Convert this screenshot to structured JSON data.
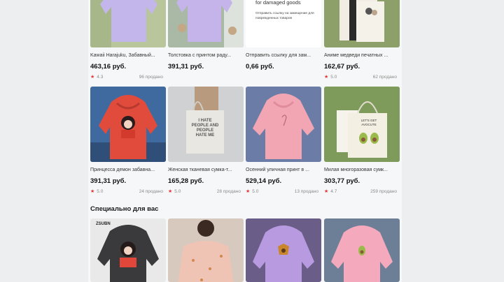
{
  "row1": [
    {
      "title": "Kawaii Harajuku, Забавный...",
      "price": "463,16 руб.",
      "rating": "4.3",
      "sold": "96 продано",
      "bg": "#b7c49a",
      "item": "#c3b6ea"
    },
    {
      "title": "Толстовка с принтом раду...",
      "price": "391,31 руб.",
      "rating": "",
      "sold": "",
      "bg": "#a7b8a3",
      "item": "#c4b4ea"
    },
    {
      "title": "Отправить ссылку для зам...",
      "price": "0,66 руб.",
      "rating": "",
      "sold": "",
      "bg": "#ffffff",
      "item": "#ffffff",
      "promo_heading": "for damaged goods",
      "promo_text": "Отправить ссылку на замещение для поврежденных товаров"
    },
    {
      "title": "Аниме медведи печатных ...",
      "price": "162,67 руб.",
      "rating": "5.0",
      "sold": "62 продано",
      "bg": "#8ea06a",
      "item": "#f1ede4"
    }
  ],
  "row2": [
    {
      "title": "Принцесса демон забавна...",
      "price": "391,31 руб.",
      "rating": "5.0",
      "sold": "24 продано",
      "bg": "#3f6aa0",
      "item": "#e04b3c"
    },
    {
      "title": "Женская тканевая сумка-т...",
      "price": "165,28 руб.",
      "rating": "5.0",
      "sold": "28 продано",
      "bg": "#cfd0d2",
      "item": "#e7e6e1",
      "bag_text": "I HATE PEOPLE AND PEOPLE HATE ME"
    },
    {
      "title": "Осенний уличная принт в ...",
      "price": "529,14 руб.",
      "rating": "5.0",
      "sold": "13 продано",
      "bg": "#6b7da6",
      "item": "#f2a6b4"
    },
    {
      "title": "Милая многоразовая сумк...",
      "price": "303,77 руб.",
      "rating": "4.7",
      "sold": "259 продано",
      "bg": "#7f9b5c",
      "item": "#f3efe3",
      "bag_text": "LET'S GET AVOCUTE"
    }
  ],
  "section": {
    "title": "Специально для вас"
  },
  "row3": [
    {
      "bg": "#e9e9ea",
      "item": "#3a3a3c",
      "label": "ZSUBN"
    },
    {
      "bg": "#d7c8bd",
      "item": "#f0c4b4"
    },
    {
      "bg": "#6a5d88",
      "item": "#b89ae0"
    },
    {
      "bg": "#6d7f96",
      "item": "#f4a9bc"
    }
  ],
  "colors": {
    "star": "#e5383b",
    "page_bg": "#f6f7f8",
    "outer_bg": "#eceef0"
  }
}
